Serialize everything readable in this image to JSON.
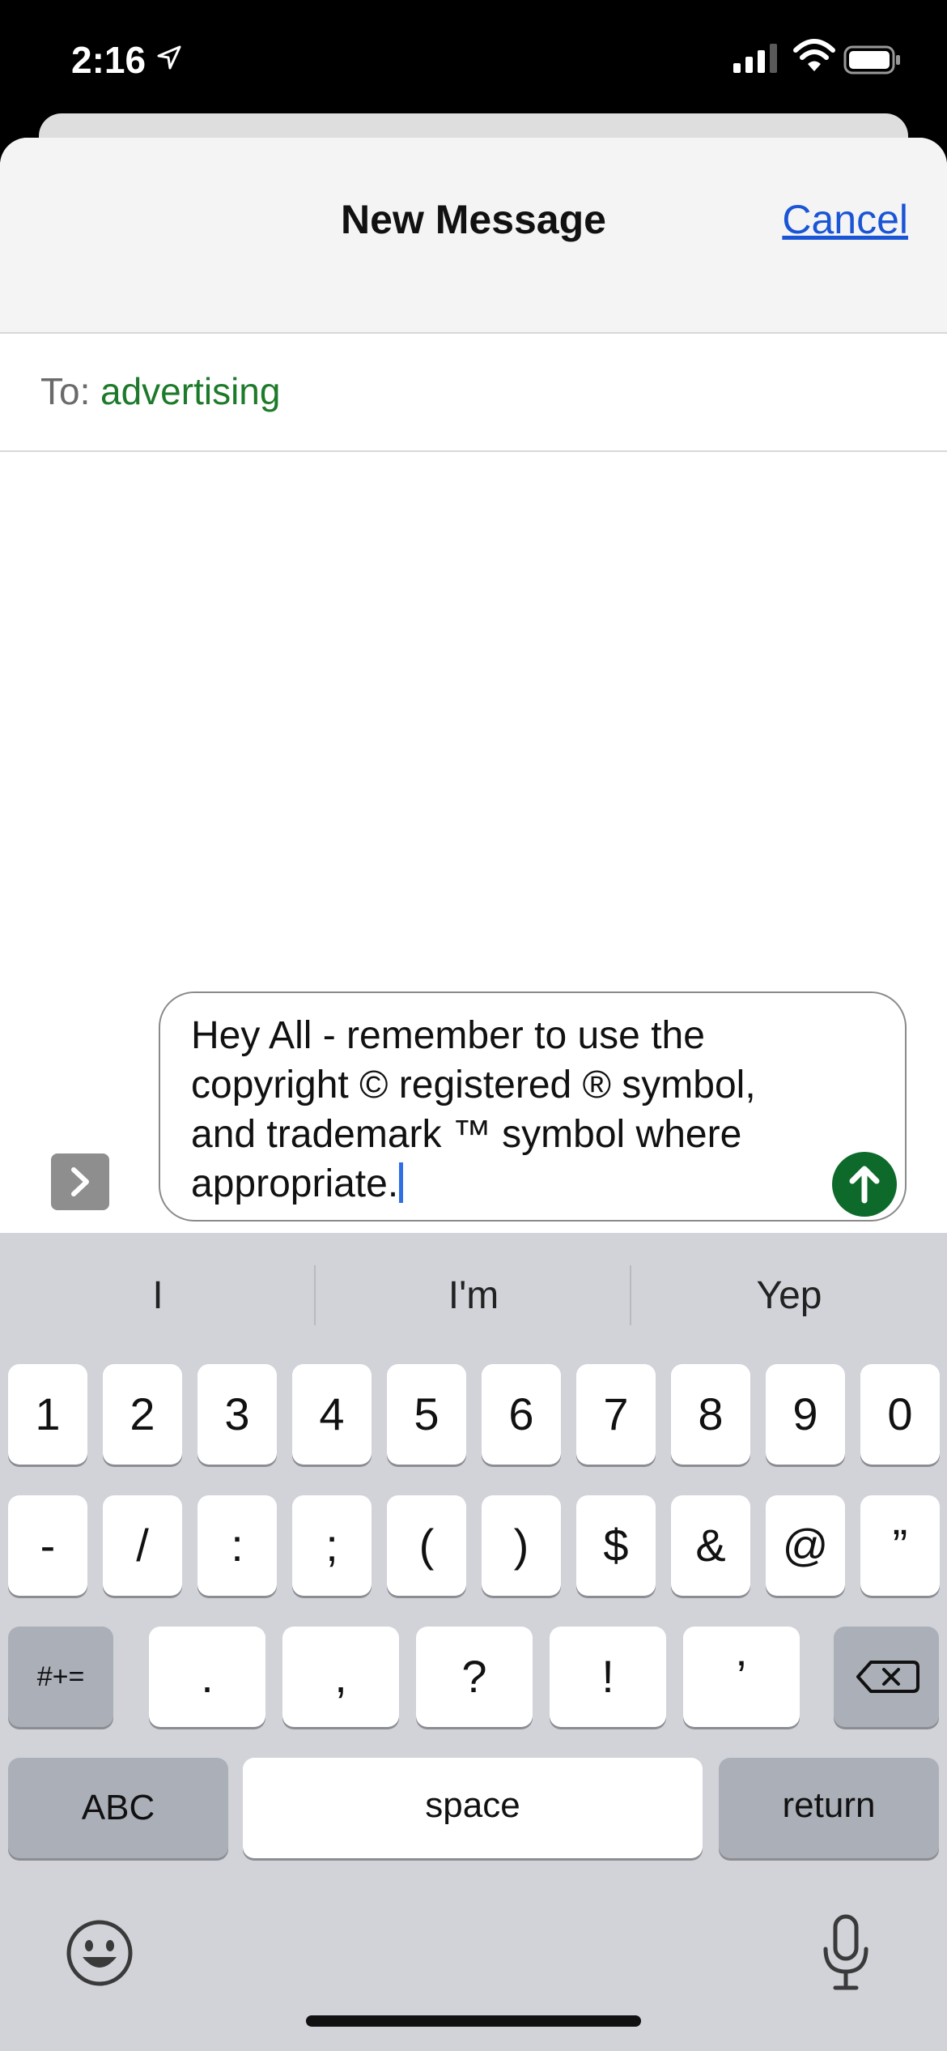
{
  "status_bar": {
    "time": "2:16"
  },
  "header": {
    "title": "New Message",
    "cancel_label": "Cancel"
  },
  "recipient": {
    "label": "To:",
    "value": "advertising"
  },
  "composer": {
    "message_lines": [
      "Hey All - remember to use the",
      "copyright © registered ® symbol,",
      "and trademark ™ symbol where",
      "appropriate."
    ]
  },
  "keyboard": {
    "suggestions": [
      "I",
      "I'm",
      "Yep"
    ],
    "row1": [
      "1",
      "2",
      "3",
      "4",
      "5",
      "6",
      "7",
      "8",
      "9",
      "0"
    ],
    "row2": [
      "-",
      "/",
      ":",
      ";",
      "(",
      ")",
      "$",
      "&",
      "@",
      "”"
    ],
    "row3": {
      "symbols_key": "#+=",
      "keys": [
        ".",
        ",",
        "?",
        "!",
        "’"
      ]
    },
    "row4": {
      "abc": "ABC",
      "space": "space",
      "return": "return"
    }
  },
  "icons": {
    "location": "location-arrow-icon",
    "signal": "cellular-signal-icon",
    "wifi": "wifi-icon",
    "battery": "battery-icon",
    "expand": "chevron-right-icon",
    "send": "arrow-up-icon",
    "delete": "delete-backspace-icon",
    "emoji": "emoji-icon",
    "mic": "microphone-icon"
  },
  "colors": {
    "accent_green": "#0d6a2a",
    "recipient_green": "#1d7a2a",
    "link_blue": "#1a55d6"
  }
}
